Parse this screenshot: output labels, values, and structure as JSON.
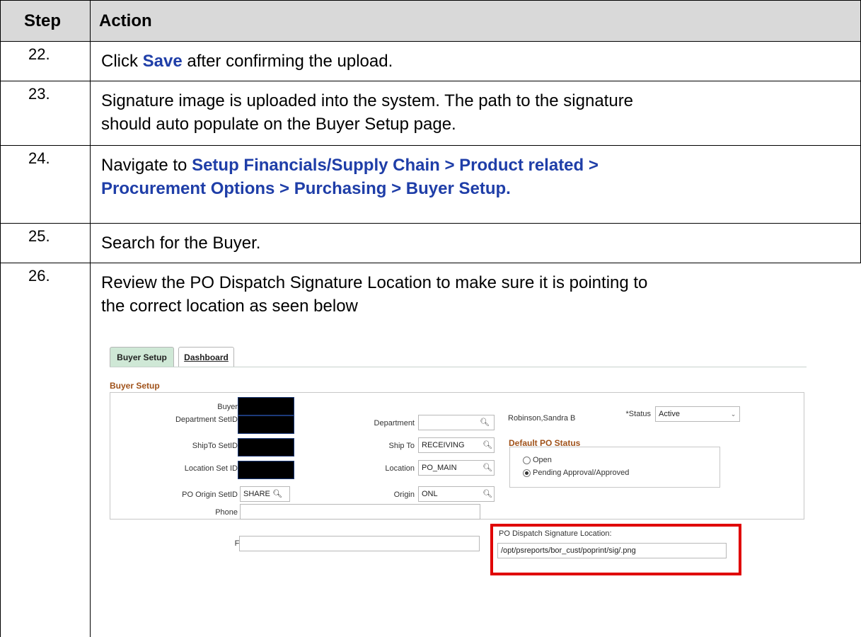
{
  "table": {
    "header": {
      "step": "Step",
      "action": "Action"
    },
    "rows": [
      {
        "step": "22.",
        "pre": "Click ",
        "link": "Save",
        "post": " after confirming the upload."
      },
      {
        "step": "23.",
        "line1": "Signature image is uploaded into the system. The path to the signature",
        "line2": "should auto populate on the Buyer Setup page."
      },
      {
        "step": "24.",
        "pre": "Navigate to ",
        "link_line1": "Setup Financials/Supply Chain > Product related >",
        "link_line2": "Procurement Options > Purchasing > Buyer Setup."
      },
      {
        "step": "25.",
        "text": "Search for the Buyer."
      },
      {
        "step": "26.",
        "line1": "Review the PO Dispatch Signature Location to make sure it is pointing to",
        "line2": "the correct location as seen below"
      }
    ]
  },
  "screenshot": {
    "tabs": [
      {
        "label": "Buyer Setup",
        "active": true
      },
      {
        "label": "Dashboard",
        "active": false
      }
    ],
    "section_title": "Buyer Setup",
    "fields": {
      "buyer_label": "Buyer",
      "dept_setid_label": "Department SetID",
      "department_label": "Department",
      "department_value": "",
      "shipto_setid_label": "ShipTo SetID",
      "shipto_label": "Ship To",
      "shipto_value": "RECEIVING",
      "location_setid_label": "Location Set ID",
      "location_label": "Location",
      "location_value": "PO_MAIN",
      "po_origin_setid_label": "PO Origin SetID",
      "po_origin_setid_value": "SHARE",
      "origin_label": "Origin",
      "origin_value": "ONL",
      "phone_label": "Phone",
      "phone_value": "",
      "fax_label": "Fax",
      "fax_value": ""
    },
    "buyer_name": "Robinson,Sandra B",
    "status_label": "*Status",
    "status_value": "Active",
    "default_po_status": {
      "title": "Default PO Status",
      "options": [
        {
          "label": "Open",
          "selected": false
        },
        {
          "label": "Pending Approval/Approved",
          "selected": true
        }
      ]
    },
    "signature": {
      "label": "PO Dispatch Signature Location:",
      "value": "/opt/psreports/bor_cust/poprint/sig/.png"
    }
  }
}
